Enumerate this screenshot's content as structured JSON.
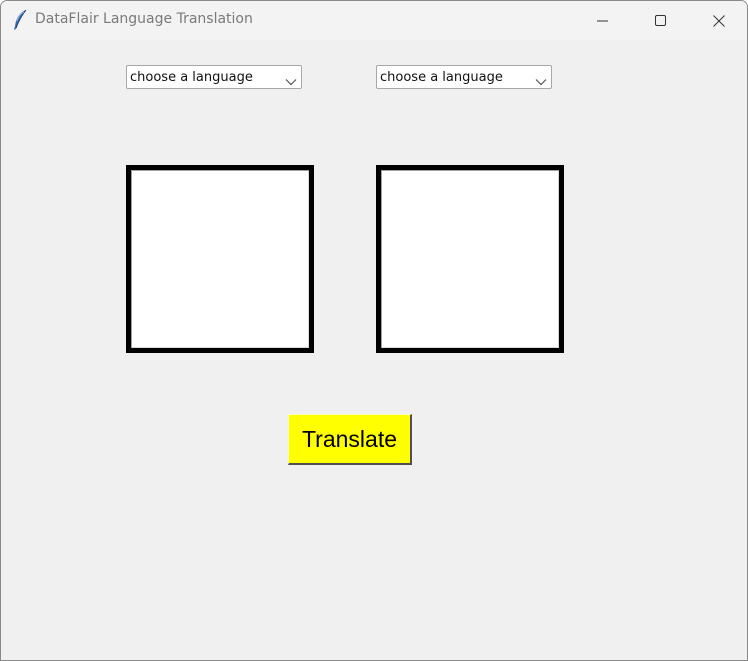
{
  "window": {
    "title": "DataFlair Language Translation",
    "icon": "feather-icon"
  },
  "controls": {
    "minimize_icon": "minimize-icon",
    "maximize_icon": "maximize-icon",
    "close_icon": "close-icon"
  },
  "source_language": {
    "selected": "choose a language",
    "icon": "chevron-down-icon"
  },
  "target_language": {
    "selected": "choose a language",
    "icon": "chevron-down-icon"
  },
  "input_text": {
    "value": ""
  },
  "output_text": {
    "value": ""
  },
  "translate_button": {
    "label": "Translate"
  },
  "colors": {
    "window_bg": "#f0f0f0",
    "titlebar_bg": "#f3f3f3",
    "button_bg": "#ffff00",
    "text_border": "#000000"
  }
}
